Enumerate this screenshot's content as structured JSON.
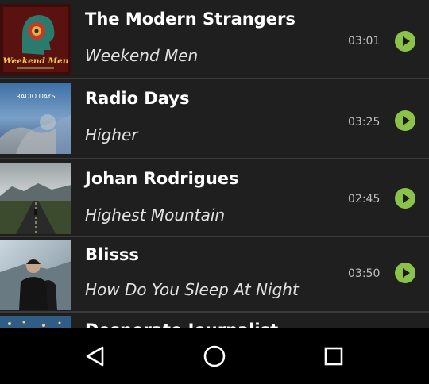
{
  "tracks": [
    {
      "artist": "The Modern Strangers",
      "title": "Weekend Men",
      "duration": "03:01",
      "art_caption": "Weekend Men"
    },
    {
      "artist": "Radio Days",
      "title": "Higher",
      "duration": "03:25",
      "art_caption": "RADIO DAYS"
    },
    {
      "artist": "Johan Rodrigues",
      "title": "Highest Mountain",
      "duration": "02:45"
    },
    {
      "artist": "Blisss",
      "title": "How Do You Sleep At Night",
      "duration": "03:50"
    },
    {
      "artist": "Desperate Journalist",
      "title": "",
      "duration": ""
    }
  ],
  "icons": {
    "play": "play-circle-icon",
    "nav_back": "back-triangle-icon",
    "nav_home": "home-circle-icon",
    "nav_recents": "recents-square-icon"
  },
  "colors": {
    "accent": "#8bc34a",
    "background": "#151515",
    "navbar": "#000000"
  }
}
